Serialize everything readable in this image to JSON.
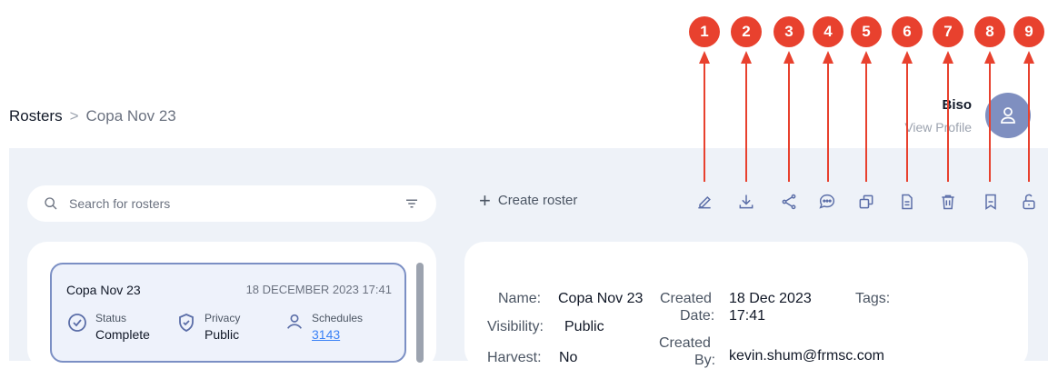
{
  "breadcrumb": {
    "root": "Rosters",
    "separator": ">",
    "current": "Copa Nov 23"
  },
  "profile": {
    "name": "Biso",
    "link": "View Profile"
  },
  "search": {
    "placeholder": "Search for rosters"
  },
  "toolbar": {
    "create_roster": "+ Create roster",
    "create_label": "Create roster"
  },
  "toolbar_icons": [
    "edit-icon",
    "download-icon",
    "share-icon",
    "comment-icon",
    "duplicate-icon",
    "document-icon",
    "delete-icon",
    "bookmark-icon",
    "unlock-icon"
  ],
  "annotations": [
    "1",
    "2",
    "3",
    "4",
    "5",
    "6",
    "7",
    "8",
    "9"
  ],
  "roster_card": {
    "title": "Copa Nov 23",
    "date": "18 DECEMBER 2023 17:41",
    "status_label": "Status",
    "status_value": "Complete",
    "privacy_label": "Privacy",
    "privacy_value": "Public",
    "schedules_label": "Schedules",
    "schedules_value": "3143"
  },
  "details": {
    "name_label": "Name:",
    "name_value": "Copa Nov 23",
    "created_date_label_1": "Created",
    "created_date_label_2": "Date:",
    "created_date_value_1": "18 Dec 2023",
    "created_date_value_2": "17:41",
    "tags_label": "Tags:",
    "visibility_label": "Visibility:",
    "visibility_value": "Public",
    "harvest_label": "Harvest:",
    "harvest_value": "No",
    "created_by_label": "Created",
    "created_by_label_2": "By:",
    "created_by_value": "kevin.shum@frmsc.com"
  },
  "colors": {
    "accent": "#7b8fc4",
    "annotation": "#e8412e",
    "background": "#eef2f8",
    "link": "#3b82f6"
  }
}
